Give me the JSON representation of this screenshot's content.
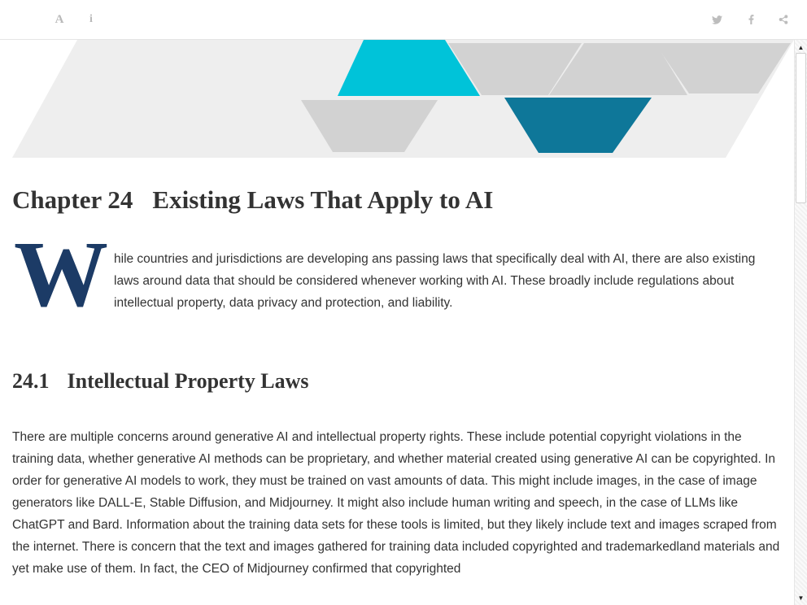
{
  "toolbar": {
    "font_icon_glyph": "A",
    "info_icon_glyph": "i",
    "icon_color": "#b9b9b9"
  },
  "banner": {
    "colors": {
      "cyan": "#00c3d9",
      "teal": "#0e7799",
      "light_gray": "#d2d2d2",
      "band_gray": "#eeeeee"
    }
  },
  "chapter": {
    "number": "Chapter 24",
    "title": "Existing Laws That Apply to AI",
    "drop_cap": "W",
    "intro_rest": "hile countries and jurisdictions are developing ans passing laws that specifically deal with AI, there are also existing laws around data that should be considered whenever working with AI. These broadly include regulations about intellectual property, data privacy and protection, and liability.",
    "drop_cap_color": "#1c3b66"
  },
  "section": {
    "number": "24.1",
    "title": "Intellectual Property Laws",
    "paragraph": "There are multiple concerns around generative AI and intellectual property rights. These include potential copyright violations in the training data, whether generative AI methods can be proprietary, and whether material created using generative AI can be copyrighted. In order for generative AI models to work, they must be trained on vast amounts of data. This might include images, in the case of image generators like DALL-E, Stable Diffusion, and Midjourney. It might also include human writing and speech, in the case of LLMs like ChatGPT and Bard. Information about the training data sets for these tools is limited, but they likely include text and images scraped from the internet. There is concern that the text and images gathered for training data included copyrighted and trademarkedland materials and yet make use of them. In fact, the CEO of Midjourney confirmed that copyrighted"
  },
  "scrollbar": {
    "up_arrow": "▲",
    "down_arrow": "▼"
  }
}
